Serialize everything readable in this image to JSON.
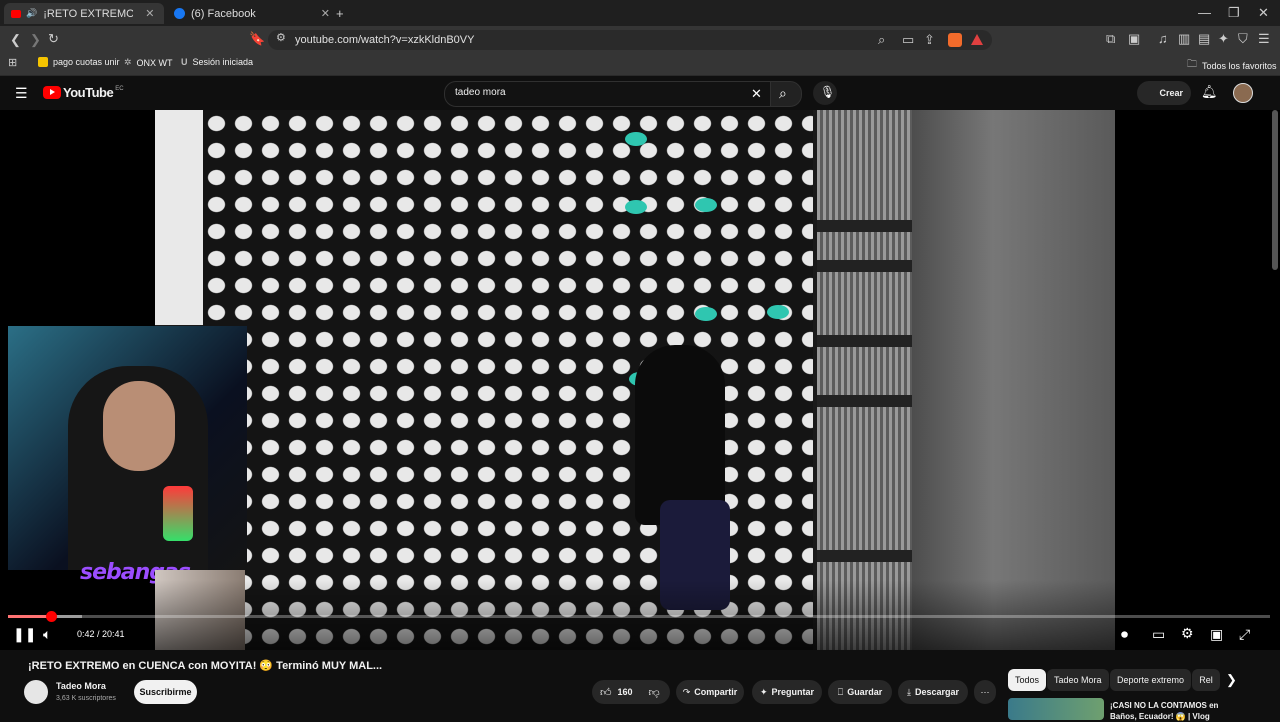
{
  "browser": {
    "tabs": [
      {
        "title": "¡RETO EXTREMO en CUEN",
        "icon": "youtube-icon",
        "active": true
      },
      {
        "title": "(6) Facebook",
        "icon": "facebook-icon",
        "active": false
      }
    ],
    "url": "youtube.com/watch?v=xzkKldnB0VY",
    "bookmarks": [
      {
        "label": "pago cuotas unir"
      },
      {
        "label": "ONX WT"
      },
      {
        "label": "Sesión iniciada"
      }
    ],
    "all_favorites_label": "Todos los favoritos"
  },
  "youtube": {
    "logo_text": "YouTube",
    "country_code": "EC",
    "search_query": "tadeo mora",
    "create_label": "Crear"
  },
  "player": {
    "watermark": "sebangas",
    "time_current": "0:42",
    "time_total": "20:41",
    "time_display": "0:42 / 20:41",
    "progress_fraction": 0.034,
    "buffered_fraction": 0.059
  },
  "video": {
    "title": "¡RETO EXTREMO en CUENCA con MOYITA! 😳 Terminó MUY MAL...",
    "channel_name": "Tadeo Mora",
    "subscribers": "3,63 K suscriptores",
    "subscribe_label": "Suscribirme",
    "likes": "160",
    "share_label": "Compartir",
    "ask_label": "Preguntar",
    "save_label": "Guardar",
    "download_label": "Descargar"
  },
  "chips": [
    {
      "label": "Todos",
      "active": true
    },
    {
      "label": "Tadeo Mora",
      "active": false
    },
    {
      "label": "Deporte extremo",
      "active": false
    },
    {
      "label": "Rel",
      "active": false
    }
  ],
  "recommendation": {
    "title_line1": "¡CASI NO LA CONTAMOS en",
    "title_line2": "Baños, Ecuador! 😱 | Vlog"
  }
}
